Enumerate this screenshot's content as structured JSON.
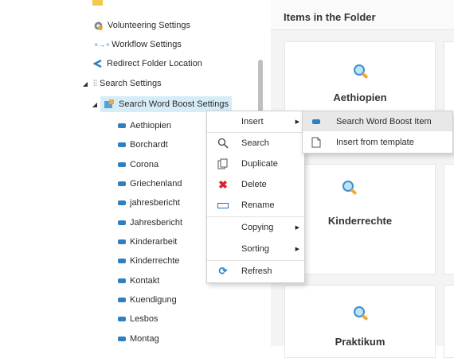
{
  "tree": {
    "items": [
      {
        "label": "Volunteering Settings",
        "icon": "settings-gear-icon"
      },
      {
        "label": "Workflow Settings",
        "icon": "workflow-icon"
      },
      {
        "label": "Redirect Folder Location",
        "icon": "redirect-icon"
      },
      {
        "label": "Search Settings",
        "icon": "search-settings-icon"
      },
      {
        "label": "Search Word Boost Settings",
        "icon": "boost-settings-icon"
      },
      {
        "label": "Aethiopien"
      },
      {
        "label": "Borchardt"
      },
      {
        "label": "Corona"
      },
      {
        "label": "Griechenland"
      },
      {
        "label": "jahresbericht"
      },
      {
        "label": "Jahresbericht"
      },
      {
        "label": "Kinderarbeit"
      },
      {
        "label": "Kinderrechte"
      },
      {
        "label": "Kontakt"
      },
      {
        "label": "Kuendigung"
      },
      {
        "label": "Lesbos"
      },
      {
        "label": "Montag"
      }
    ]
  },
  "folder_panel": {
    "title": "Items in the Folder",
    "cards": [
      "Aethiopien",
      "Kinderrechte",
      "Praktikum"
    ]
  },
  "context_menu": {
    "items": [
      "Insert",
      "Search",
      "Duplicate",
      "Delete",
      "Rename",
      "Copying",
      "Sorting",
      "Refresh"
    ]
  },
  "insert_submenu": {
    "items": [
      "Search Word Boost Item",
      "Insert from template"
    ]
  },
  "colors": {
    "selection": "#d6ecf7",
    "highlight": "#e8e8e8",
    "accent_blue": "#2f7fc2",
    "delete_red": "#d6262b"
  }
}
